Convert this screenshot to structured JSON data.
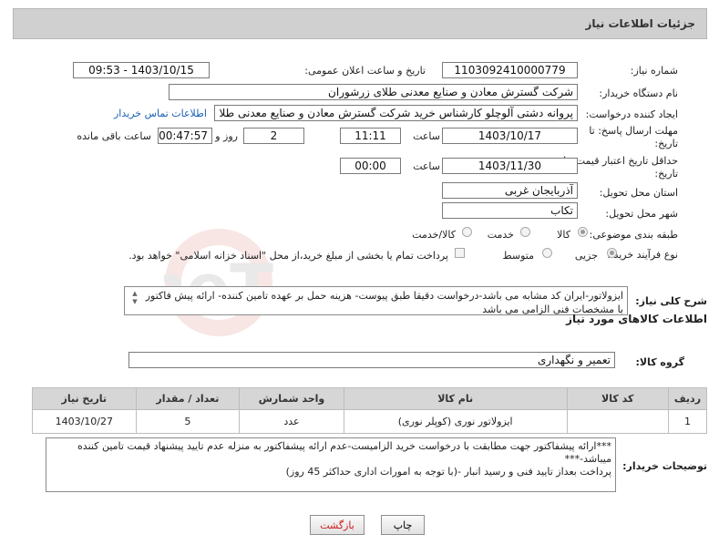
{
  "header": {
    "title": "جزئیات اطلاعات نیاز"
  },
  "fields": {
    "need_number_label": "شماره نیاز:",
    "need_number": "1103092410000779",
    "announce_label": "تاریخ و ساعت اعلان عمومی:",
    "announce_value": "1403/10/15 - 09:53",
    "buyer_org_label": "نام دستگاه خریدار:",
    "buyer_org": "شرکت گسترش معادن و صنایع معدنی طلای زرشوران",
    "creator_label": "ایجاد کننده درخواست:",
    "creator": "پروانه  دشتی آلوچلو کارشناس خرید شرکت گسترش معادن و صنایع معدنی طلا",
    "contact_link": "اطلاعات تماس خریدار",
    "deadline_label_1": "مهلت ارسال پاسخ: تا",
    "deadline_label_2": "تاریخ:",
    "deadline_date": "1403/10/17",
    "time_label": "ساعت",
    "deadline_time": "11:11",
    "days_value": "2",
    "days_label": "روز و",
    "remaining_time": "00:47:57",
    "remaining_label": "ساعت باقی مانده",
    "validity_label_1": "حداقل تاریخ اعتبار قیمت: تا",
    "validity_label_2": "تاریخ:",
    "validity_date": "1403/11/30",
    "validity_time": "00:00",
    "province_label": "استان محل تحویل:",
    "province": "آذربایجان غربی",
    "city_label": "شهر محل تحویل:",
    "city": "تکاب",
    "category_label": "طبقه بندی موضوعی:",
    "category_options": [
      "کالا",
      "خدمت",
      "کالا/خدمت"
    ],
    "process_label": "نوع فرآیند خرید :",
    "process_options": [
      "جزیی",
      "متوسط"
    ],
    "payment_note": "پرداخت تمام یا بخشی از مبلغ خرید،از محل \"اسناد خزانه اسلامی\" خواهد بود."
  },
  "description": {
    "label": "شرح کلی نیاز:",
    "text": "ایزولاتور-ایران کد مشابه می باشد-درخواست دقیقا طبق پیوست- هزینه حمل بر عهده تامین کننده- ارائه پیش فاکتور با مشخصات فنی الزامی می باشد"
  },
  "goods_section": {
    "title": "اطلاعات کالاهای مورد نیاز",
    "group_label": "گروه کالا:",
    "group_value": "تعمیر و نگهداری"
  },
  "table": {
    "headers": [
      "ردیف",
      "کد کالا",
      "نام کالا",
      "واحد شمارش",
      "تعداد / مقدار",
      "تاریخ نیاز"
    ],
    "rows": [
      [
        "1",
        "",
        "ایزولاتور نوری (کوپلر نوری)",
        "عدد",
        "5",
        "1403/10/27"
      ]
    ]
  },
  "buyer_notes": {
    "label": "توضیحات خریدار:",
    "line1": "***ارائه پیشفاکتور جهت مطابقت با درخواست خرید الزامیست-عدم ارائه پیشفاکتور به منزله عدم تایید پیشنهاد قیمت تامین کننده میباشد-***",
    "line2": "پرداخت بعداز تایید فنی و رسید انبار -(با توجه به امورات اداری حداکثر 45 روز)"
  },
  "buttons": {
    "print": "چاپ",
    "back": "بازگشت"
  },
  "watermark": {
    "text": "AriaTender.neT"
  }
}
